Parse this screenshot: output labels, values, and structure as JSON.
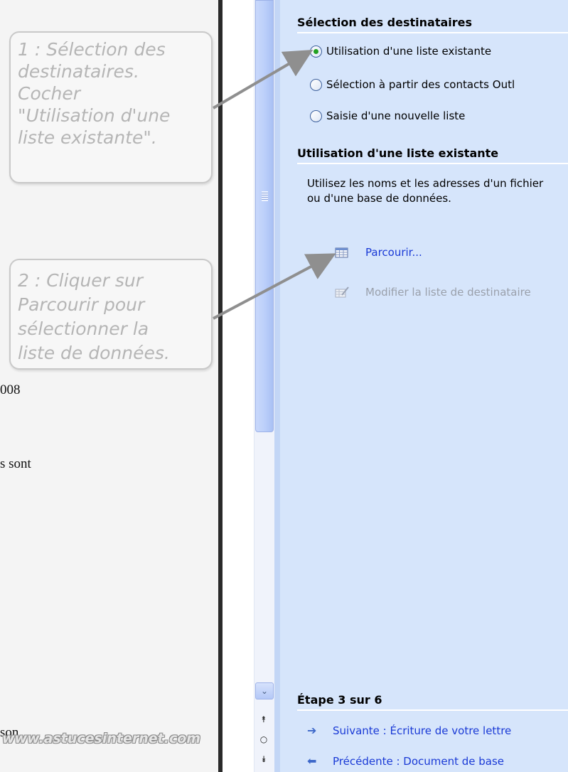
{
  "document": {
    "fragments": [
      "008",
      "s sont",
      "son"
    ]
  },
  "callouts": [
    {
      "lines": [
        "1 : Sélection des",
        "destinataires.",
        "Cocher",
        "\"Utilisation d'une",
        "liste existante\"."
      ]
    },
    {
      "lines": [
        "2 : Cliquer sur",
        "Parcourir pour",
        "sélectionner la",
        "liste de données."
      ]
    }
  ],
  "watermark": "www.astucesinternet.com",
  "pane": {
    "section1_title": "Sélection des destinataires",
    "radios": [
      {
        "label": "Utilisation d'une liste existante",
        "checked": true
      },
      {
        "label": "Sélection à partir des contacts Outl",
        "checked": false
      },
      {
        "label": "Saisie d'une nouvelle liste",
        "checked": false
      }
    ],
    "section2_title": "Utilisation d'une liste existante",
    "description": "Utilisez les noms et les adresses d'un fichier ou d'une base de données.",
    "browse_link": "Parcourir...",
    "edit_link": "Modifier la liste de destinataire",
    "step_title": "Étape 3 sur 6",
    "next_link": "Suivante : Écriture de votre lettre",
    "prev_link": "Précédente : Document de base"
  },
  "icons": {
    "browse": "table-grid-icon",
    "edit": "edit-list-icon",
    "next": "arrow-right-icon",
    "prev": "arrow-left-icon",
    "scroll_down": "chevron-down-icon",
    "prev_page": "double-up-arrow-icon",
    "select_browse": "circle-icon",
    "next_page": "double-down-arrow-icon"
  },
  "colors": {
    "pane_background": "#d6e5fb",
    "link": "#1a3ad6",
    "disabled_link": "#9aa0ab",
    "radio_checked": "#21a121"
  }
}
